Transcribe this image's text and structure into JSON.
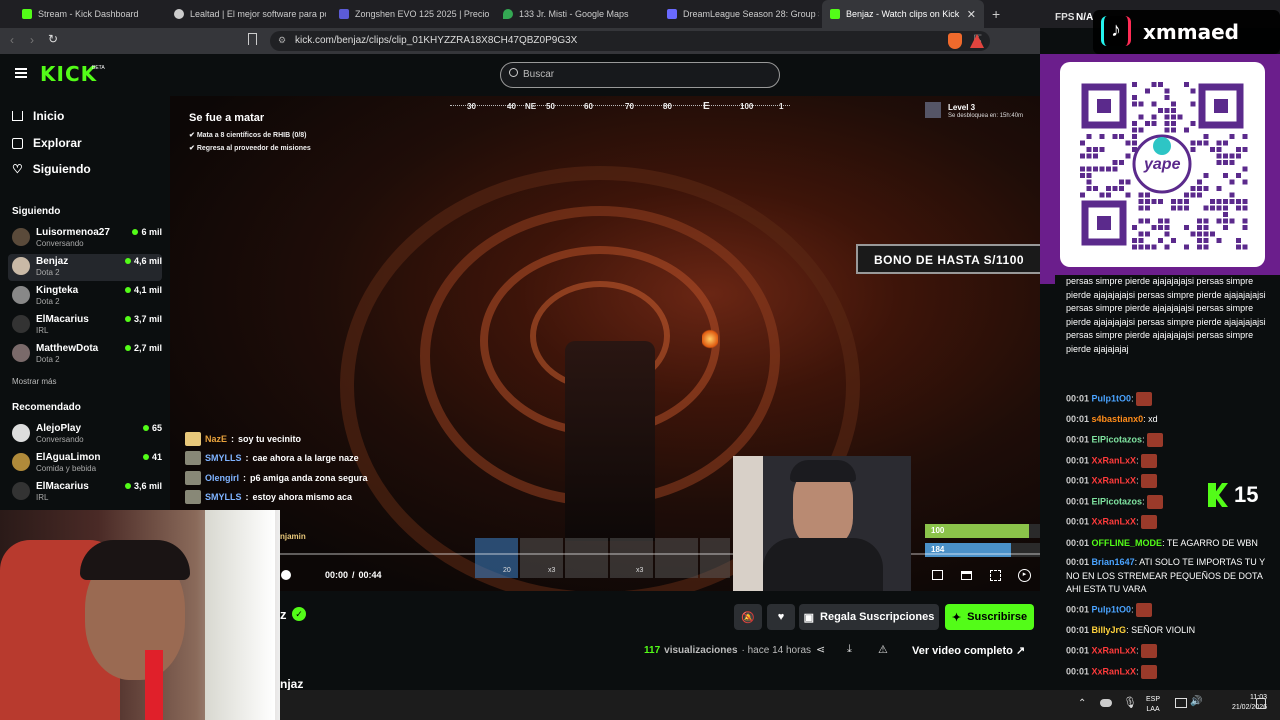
{
  "browser": {
    "tabs": [
      {
        "title": "Stream - Kick Dashboard",
        "color": "#53fc18"
      },
      {
        "title": "Lealtad | El mejor software para pote",
        "color": "#cccccc"
      },
      {
        "title": "Zongshen EVO 125 2025 | Precio $ 1",
        "color": "#5b5bd6"
      },
      {
        "title": "133 Jr. Misti - Google Maps",
        "color": "#34a853"
      },
      {
        "title": "DreamLeague Season 28: Group Stag",
        "color": "#6a6aff"
      },
      {
        "title": "Benjaz - Watch clips on Kick",
        "color": "#53fc18"
      }
    ],
    "url": "kick.com/benjaz/clips/clip_01KHYZZRA18X8CH47QBZ0P9G3X",
    "fps_label": "FPS",
    "fps_value": "N/A"
  },
  "kick": {
    "logo": "KICK",
    "logo_badge": "BETA",
    "search_placeholder": "Buscar"
  },
  "sidebar": {
    "nav": [
      {
        "label": "Inicio",
        "icon": "home-icon"
      },
      {
        "label": "Explorar",
        "icon": "compass-icon"
      },
      {
        "label": "Siguiendo",
        "icon": "heart-icon"
      }
    ],
    "following_heading": "Siguiendo",
    "following": [
      {
        "name": "Luisormenoa27",
        "category": "Conversando",
        "viewers": "6 mil"
      },
      {
        "name": "Benjaz",
        "category": "Dota 2",
        "viewers": "4,6 mil"
      },
      {
        "name": "Kingteka",
        "category": "Dota 2",
        "viewers": "4,1 mil"
      },
      {
        "name": "ElMacarius",
        "category": "IRL",
        "viewers": "3,7 mil"
      },
      {
        "name": "MatthewDota",
        "category": "Dota 2",
        "viewers": "2,7 mil"
      }
    ],
    "show_more": "Mostrar más",
    "recommended_heading": "Recomendado",
    "recommended": [
      {
        "name": "AlejoPlay",
        "category": "Conversando",
        "viewers": "65"
      },
      {
        "name": "ElAguaLimon",
        "category": "Comida y bebida",
        "viewers": "41"
      },
      {
        "name": "ElMacarius",
        "category": "IRL",
        "viewers": "3,6 mil"
      }
    ]
  },
  "game_hud": {
    "quest_title": "Se fue a matar",
    "objectives": [
      "Mata a 8 científicos de RHIB (0/8)",
      "Regresa al proveedor de misiones"
    ],
    "compass": [
      "30",
      "40",
      "NE",
      "50",
      "60",
      "70",
      "80",
      "E",
      "100",
      "1"
    ],
    "level_title": "Level 3",
    "level_sub": "Se desbloquea en: 15h:40m",
    "banner": "BONO DE HASTA S/1100",
    "health": "100",
    "armor": "184",
    "hotbar_counts": [
      "20",
      "x3",
      "x3"
    ]
  },
  "stream_chat_overlay": [
    {
      "user": "NazE",
      "text": "soy tu vecinito",
      "color": "#e8a23c"
    },
    {
      "user": "SMYLLS",
      "text": "cae ahora a la large naze",
      "color": "#7fb3ff"
    },
    {
      "user": "Olengirl",
      "text": "p6 amiga anda zona segura",
      "color": "#7fb3ff"
    },
    {
      "user": "SMYLLS",
      "text": "estoy ahora mismo aca",
      "color": "#7fb3ff"
    }
  ],
  "player": {
    "time_current": "00:00",
    "time_separator": "/",
    "time_total": "00:44",
    "progress": 0,
    "partial_user": "njamin"
  },
  "clip_info": {
    "streamer_partial": "z",
    "title_partial": "njaz",
    "views_count": "117",
    "views_label": "visualizaciones",
    "time_ago": "· hace 14 horas",
    "gift_label": "Regala Suscripciones",
    "subscribe_label": "Suscribirse",
    "watch_full_label": "Ver video completo"
  },
  "overlay": {
    "tiktok_handle": "xmmaed",
    "qr_label": "yape",
    "k_count": "15"
  },
  "chat": {
    "spam_text": "persas simpre pierde ajajajajajsi persas simpre pierde ajajajajajsi persas simpre pierde ajajajajajsi persas simpre pierde ajajajajajsi persas simpre pierde ajajajajajsi persas simpre pierde ajajajajajsi persas simpre pierde ajajajajajsi persas simpre pierde ajajajajaj",
    "messages": [
      {
        "time": "00:01",
        "user": "Pulp1tO0",
        "text": ":",
        "color": "#4aa3ff",
        "emote": true
      },
      {
        "time": "00:01",
        "user": "s4bastianx0",
        "text": ": xd",
        "color": "#ff8c1a",
        "emote": false
      },
      {
        "time": "00:01",
        "user": "ElPicotazos",
        "text": ":",
        "color": "#7fe3a0",
        "emote": true
      },
      {
        "time": "00:01",
        "user": "XxRanLxX",
        "text": ":",
        "color": "#ff3b3b",
        "emote": true
      },
      {
        "time": "00:01",
        "user": "XxRanLxX",
        "text": ":",
        "color": "#ff3b3b",
        "emote": true
      },
      {
        "time": "00:01",
        "user": "ElPicotazos",
        "text": ":",
        "color": "#7fe3a0",
        "emote": true
      },
      {
        "time": "00:01",
        "user": "XxRanLxX",
        "text": ":",
        "color": "#ff3b3b",
        "emote": true
      },
      {
        "time": "00:01",
        "user": "OFFLINE_MODE",
        "text": ": TE AGARRO DE WBN",
        "color": "#53fc18",
        "emote": false
      },
      {
        "time": "00:01",
        "user": "Brian1647",
        "text": ": ATI SOLO TE IMPORTAS TU Y NO EN LOS STREMEAR PEQUEÑOS DE DOTA AHI ESTA TU VARA",
        "color": "#4aa3ff",
        "emote": false
      },
      {
        "time": "00:01",
        "user": "Pulp1tO0",
        "text": ":",
        "color": "#4aa3ff",
        "emote": true
      },
      {
        "time": "00:01",
        "user": "BillyJrG",
        "text": ": SEÑOR VIOLIN",
        "color": "#ffd23c",
        "emote": false
      },
      {
        "time": "00:01",
        "user": "XxRanLxX",
        "text": ":",
        "color": "#ff3b3b",
        "emote": true
      },
      {
        "time": "00:01",
        "user": "XxRanLxX",
        "text": ":",
        "color": "#ff3b3b",
        "emote": true
      }
    ]
  },
  "taskbar": {
    "lang_line1": "ESP",
    "lang_line2": "LAA",
    "time": "11:03",
    "date": "21/02/2026"
  },
  "colors": {
    "kick_green": "#53fc18",
    "overlay_purple": "#6b1e8c"
  }
}
